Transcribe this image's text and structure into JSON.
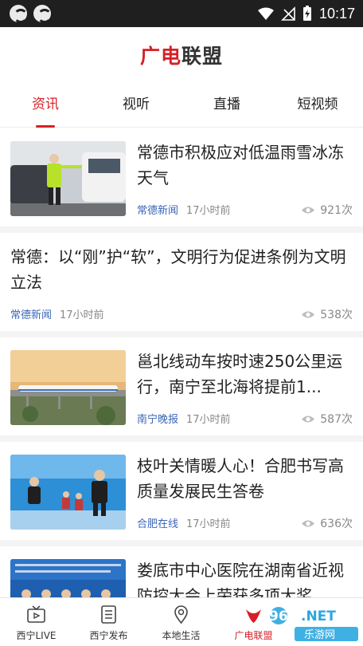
{
  "status_bar": {
    "time": "10:17"
  },
  "header": {
    "logo_red": "广电",
    "logo_dark": "联盟"
  },
  "tabs": [
    {
      "label": "资讯",
      "active": true
    },
    {
      "label": "视听",
      "active": false
    },
    {
      "label": "直播",
      "active": false
    },
    {
      "label": "短视频",
      "active": false
    }
  ],
  "feed": [
    {
      "type": "image",
      "title": "常德市积极应对低温雨雪冰冻天气",
      "source": "常德新闻",
      "time": "17小时前",
      "views": "921次"
    },
    {
      "type": "text",
      "title": "常德：以“刚”护“软”，文明行为促进条例为文明立法",
      "source": "常德新闻",
      "time": "17小时前",
      "views": "538次"
    },
    {
      "type": "image",
      "title": "邕北线动车按时速250公里运行，南宁至北海将提前1...",
      "source": "南宁晚报",
      "time": "17小时前",
      "views": "587次"
    },
    {
      "type": "image",
      "title": "枝叶关情暖人心！合肥书写高质量发展民生答卷",
      "source": "合肥在线",
      "time": "17小时前",
      "views": "636次"
    },
    {
      "type": "image",
      "title": "娄底市中心医院在湖南省近视防控大会上荣获多项大奖",
      "source": "",
      "time": "",
      "views": ""
    }
  ],
  "bottom_nav": [
    {
      "label": "西宁LIVE",
      "icon": "tv-icon",
      "active": false
    },
    {
      "label": "西宁发布",
      "icon": "document-icon",
      "active": false
    },
    {
      "label": "本地生活",
      "icon": "location-pin-icon",
      "active": false
    },
    {
      "label": "广电联盟",
      "icon": "alliance-icon",
      "active": true
    }
  ],
  "watermark": {
    "text_top": "962.NET",
    "text_bottom": "乐游网"
  },
  "colors": {
    "accent": "#d71f26",
    "source_blue": "#3a66b8",
    "meta_gray": "#888888",
    "status_bar": "#1f1f1f"
  }
}
